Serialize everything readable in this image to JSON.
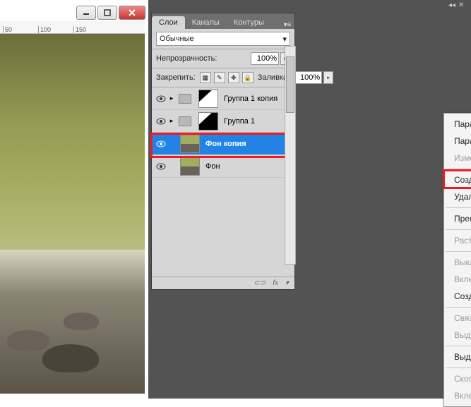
{
  "ruler": {
    "marks": [
      "50",
      "100",
      "150"
    ]
  },
  "panel": {
    "tabs": [
      {
        "label": "Слои",
        "active": true
      },
      {
        "label": "Каналы",
        "active": false
      },
      {
        "label": "Контуры",
        "active": false
      }
    ],
    "blend_mode": "Обычные",
    "opacity_label": "Непрозрачность:",
    "opacity_value": "100%",
    "lock_label": "Закрепить:",
    "fill_label": "Заливка:",
    "fill_value": "100%"
  },
  "layers": [
    {
      "name": "Группа 1 копия",
      "type": "group",
      "mask": "white"
    },
    {
      "name": "Группа 1",
      "type": "group",
      "mask": "black"
    },
    {
      "name": "Фон копия",
      "type": "image",
      "selected": true
    },
    {
      "name": "Фон",
      "type": "image"
    }
  ],
  "footer": {
    "link": "⊂⊃",
    "fx": "fx"
  },
  "context_menu": {
    "items": [
      {
        "label": "Параметры слоя...",
        "enabled": true
      },
      {
        "label": "Параметры наложения...",
        "enabled": true
      },
      {
        "label": "Изменить корректировку...",
        "enabled": false
      },
      {
        "sep": true
      },
      {
        "label": "Создать дубликат слоя...",
        "enabled": true,
        "highlight": true
      },
      {
        "label": "Удалить слой",
        "enabled": true
      },
      {
        "sep": true
      },
      {
        "label": "Преобразовать в смарт-объект",
        "enabled": true
      },
      {
        "sep": true
      },
      {
        "label": "Растрировать слой",
        "enabled": false
      },
      {
        "sep": true
      },
      {
        "label": "Выключить слой-маску",
        "enabled": false
      },
      {
        "label": "Включить векторную маску",
        "enabled": false
      },
      {
        "label": "Создать обтравочную маску",
        "enabled": true
      },
      {
        "sep": true
      },
      {
        "label": "Связать слои",
        "enabled": false
      },
      {
        "label": "Выделить связанные слои",
        "enabled": false
      },
      {
        "sep": true
      },
      {
        "label": "Выделить похожие слои",
        "enabled": true
      },
      {
        "sep": true
      },
      {
        "label": "Скопировать стиль слоя",
        "enabled": false
      },
      {
        "label": "Вклеить стиль слоя",
        "enabled": false
      }
    ]
  }
}
